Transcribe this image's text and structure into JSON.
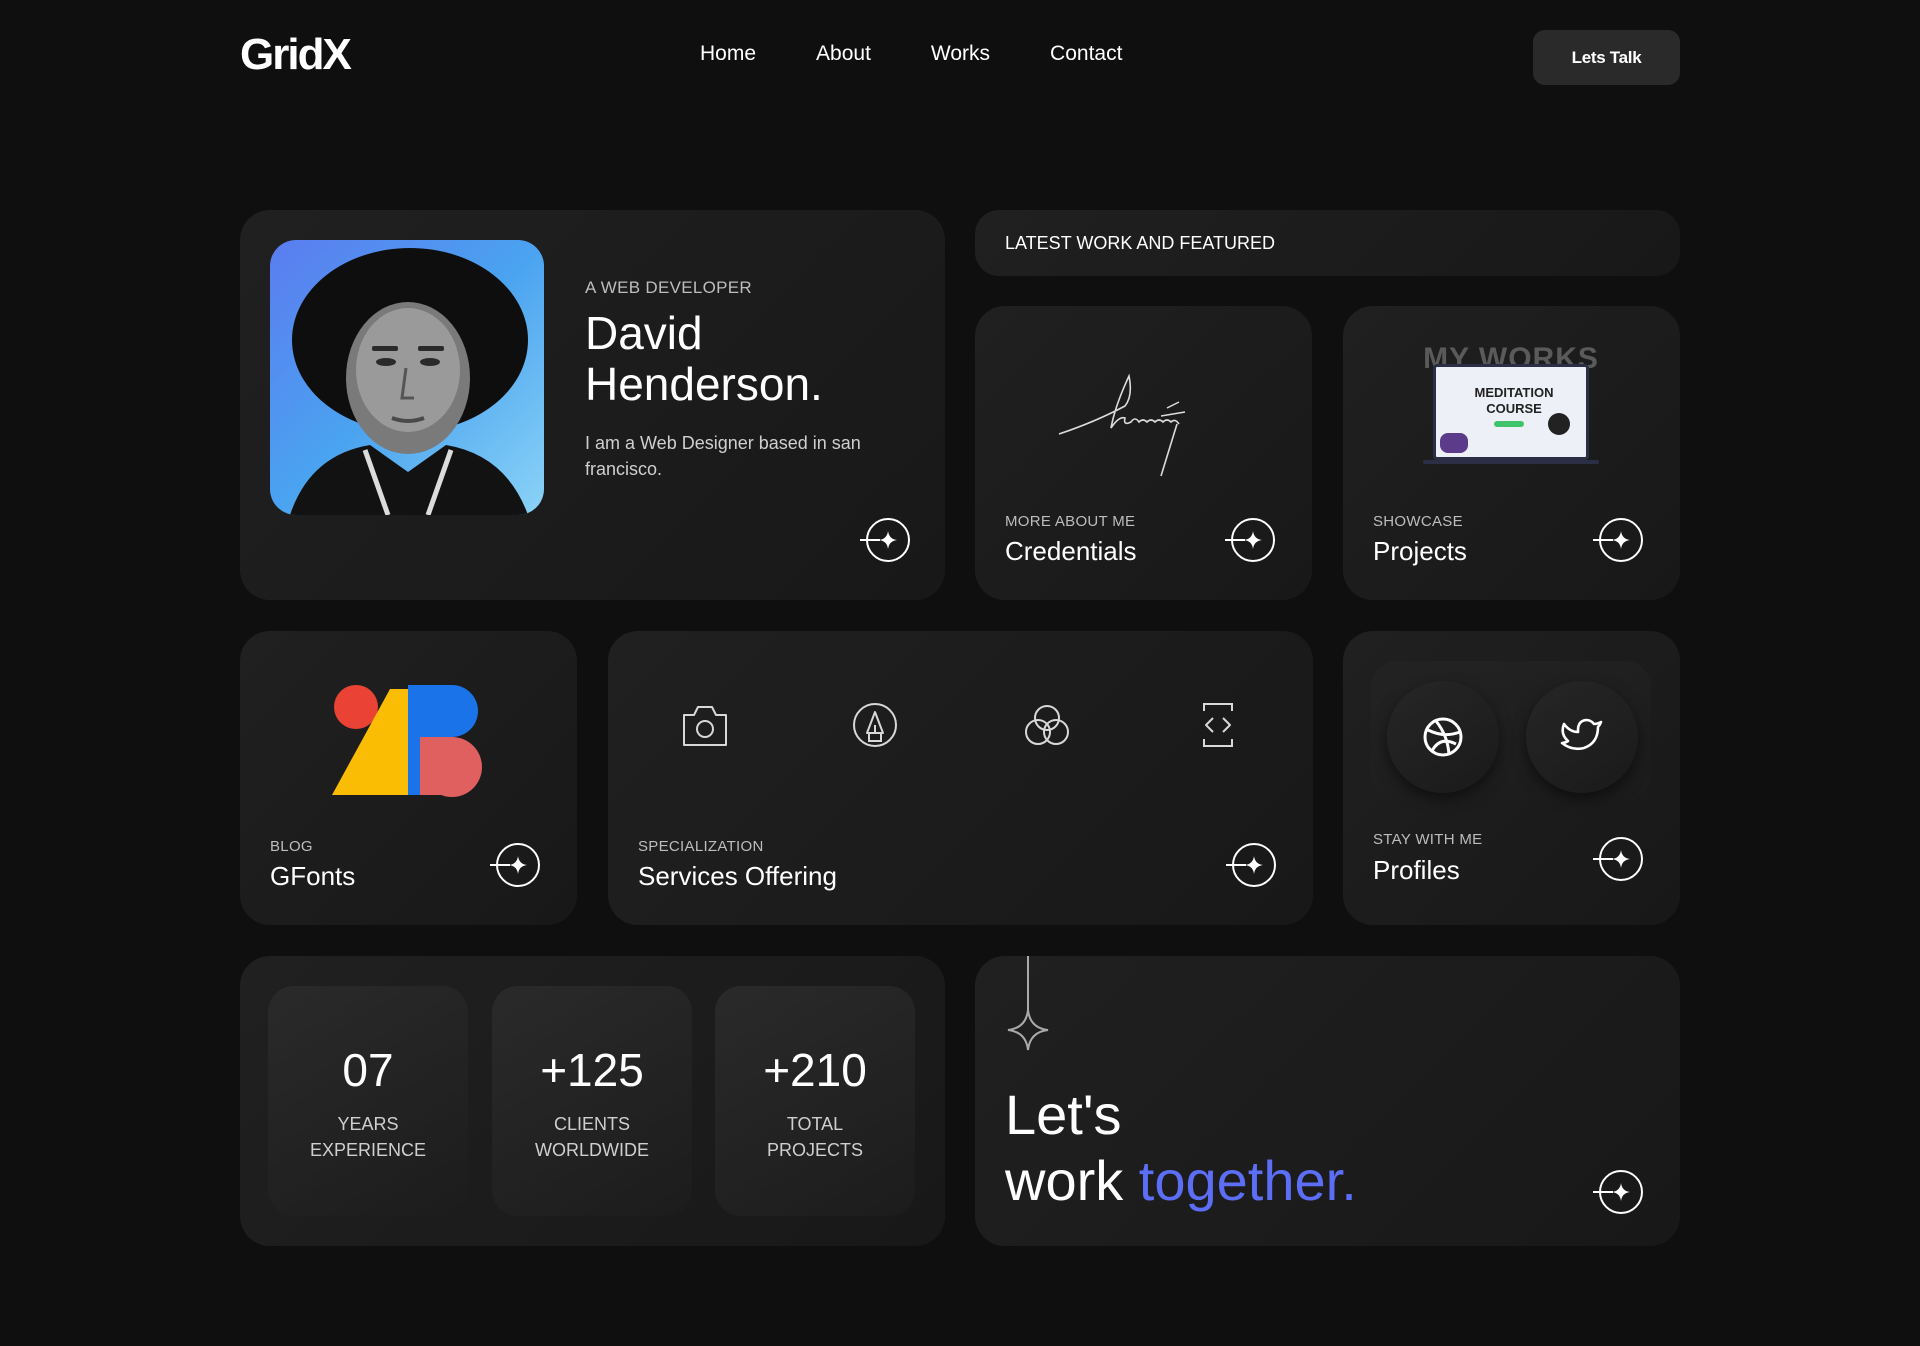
{
  "header": {
    "logo": "GridX",
    "nav": [
      "Home",
      "About",
      "Works",
      "Contact"
    ],
    "cta": "Lets Talk"
  },
  "profile": {
    "eyebrow": "A WEB DEVELOPER",
    "name_line1": "David",
    "name_line2": "Henderson.",
    "bio": "I am a Web Designer based in san francisco."
  },
  "featured_banner": "LATEST WORK AND FEATURED",
  "credentials": {
    "eyebrow": "MORE ABOUT ME",
    "title": "Credentials"
  },
  "projects": {
    "eyebrow": "SHOWCASE",
    "title": "Projects",
    "thumb_heading": "MY WORKS",
    "thumb_screen_line1": "MEDITATION",
    "thumb_screen_line2": "COURSE"
  },
  "blog": {
    "eyebrow": "BLOG",
    "title": "GFonts"
  },
  "services": {
    "eyebrow": "SPECIALIZATION",
    "title": "Services Offering",
    "icons": [
      "camera-icon",
      "pen-tool-icon",
      "color-circles-icon",
      "code-icon"
    ]
  },
  "profiles": {
    "eyebrow": "STAY WITH ME",
    "title": "Profiles",
    "icons": [
      "dribbble-icon",
      "twitter-icon"
    ]
  },
  "stats": [
    {
      "value": "07",
      "label_line1": "YEARS",
      "label_line2": "EXPERIENCE"
    },
    {
      "value": "+125",
      "label_line1": "CLIENTS",
      "label_line2": "WORLDWIDE"
    },
    {
      "value": "+210",
      "label_line1": "TOTAL",
      "label_line2": "PROJECTS"
    }
  ],
  "cta_card": {
    "line1": "Let's",
    "line2_plain": "work",
    "line2_accent": "together.",
    "accent_color": "#5b6ef5"
  }
}
